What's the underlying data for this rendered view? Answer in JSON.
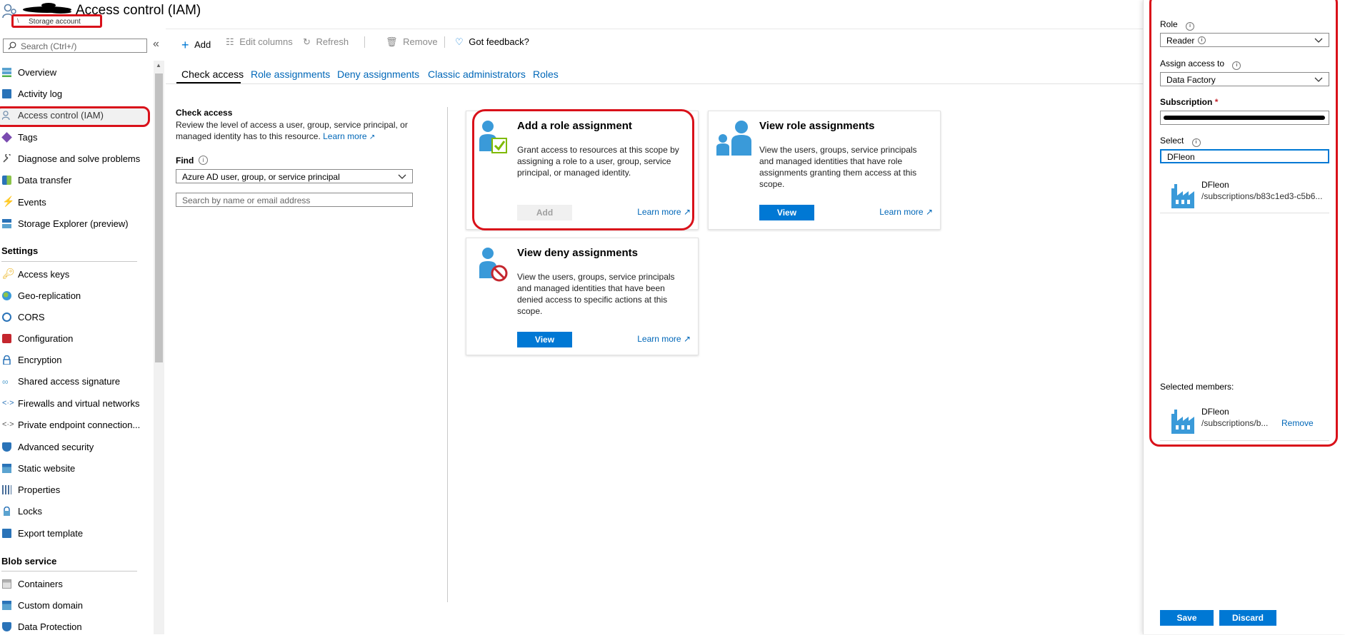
{
  "header": {
    "title": "Access control (IAM)",
    "subtitle": "Storage account"
  },
  "sidebar": {
    "search_placeholder": "Search (Ctrl+/)",
    "collapse": "«",
    "top_items": [
      {
        "label": "Overview"
      },
      {
        "label": "Activity log"
      },
      {
        "label": "Access control (IAM)"
      },
      {
        "label": "Tags"
      },
      {
        "label": "Diagnose and solve problems"
      },
      {
        "label": "Data transfer"
      },
      {
        "label": "Events"
      },
      {
        "label": "Storage Explorer (preview)"
      }
    ],
    "settings_heading": "Settings",
    "settings_items": [
      {
        "label": "Access keys"
      },
      {
        "label": "Geo-replication"
      },
      {
        "label": "CORS"
      },
      {
        "label": "Configuration"
      },
      {
        "label": "Encryption"
      },
      {
        "label": "Shared access signature"
      },
      {
        "label": "Firewalls and virtual networks"
      },
      {
        "label": "Private endpoint connection..."
      },
      {
        "label": "Advanced security"
      },
      {
        "label": "Static website"
      },
      {
        "label": "Properties"
      },
      {
        "label": "Locks"
      },
      {
        "label": "Export template"
      }
    ],
    "blob_heading": "Blob service",
    "blob_items": [
      {
        "label": "Containers"
      },
      {
        "label": "Custom domain"
      },
      {
        "label": "Data Protection"
      }
    ]
  },
  "toolbar": {
    "add": "Add",
    "edit_columns": "Edit columns",
    "refresh": "Refresh",
    "remove": "Remove",
    "feedback": "Got feedback?"
  },
  "tabs": [
    "Check access",
    "Role assignments",
    "Deny assignments",
    "Classic administrators",
    "Roles"
  ],
  "check_access": {
    "heading": "Check access",
    "desc": "Review the level of access a user, group, service principal, or managed identity has to this resource.",
    "learn_more": "Learn more",
    "find_label": "Find",
    "find_value": "Azure AD user, group, or service principal",
    "search_placeholder": "Search by name or email address"
  },
  "cards": {
    "add_role": {
      "title": "Add a role assignment",
      "desc": "Grant access to resources at this scope by assigning a role to a user, group, service principal, or managed identity.",
      "button": "Add",
      "learn_more": "Learn more"
    },
    "view_role": {
      "title": "View role assignments",
      "desc": "View the users, groups, service principals and managed identities that have role assignments granting them access at this scope.",
      "button": "View",
      "learn_more": "Learn more"
    },
    "view_deny": {
      "title": "View deny assignments",
      "desc": "View the users, groups, service principals and managed identities that have been denied access to specific actions at this scope.",
      "button": "View",
      "learn_more": "Learn more"
    }
  },
  "panel": {
    "role_label": "Role",
    "role_value": "Reader",
    "assign_label": "Assign access to",
    "assign_value": "Data Factory",
    "subscription_label": "Subscription",
    "required_mark": "*",
    "select_label": "Select",
    "select_value": "DFleon",
    "result_name": "DFleon",
    "result_path": "/subscriptions/b83c1ed3-c5b6...",
    "selected_members_label": "Selected members:",
    "member_name": "DFleon",
    "member_path": "/subscriptions/b...",
    "remove": "Remove",
    "save": "Save",
    "discard": "Discard"
  }
}
